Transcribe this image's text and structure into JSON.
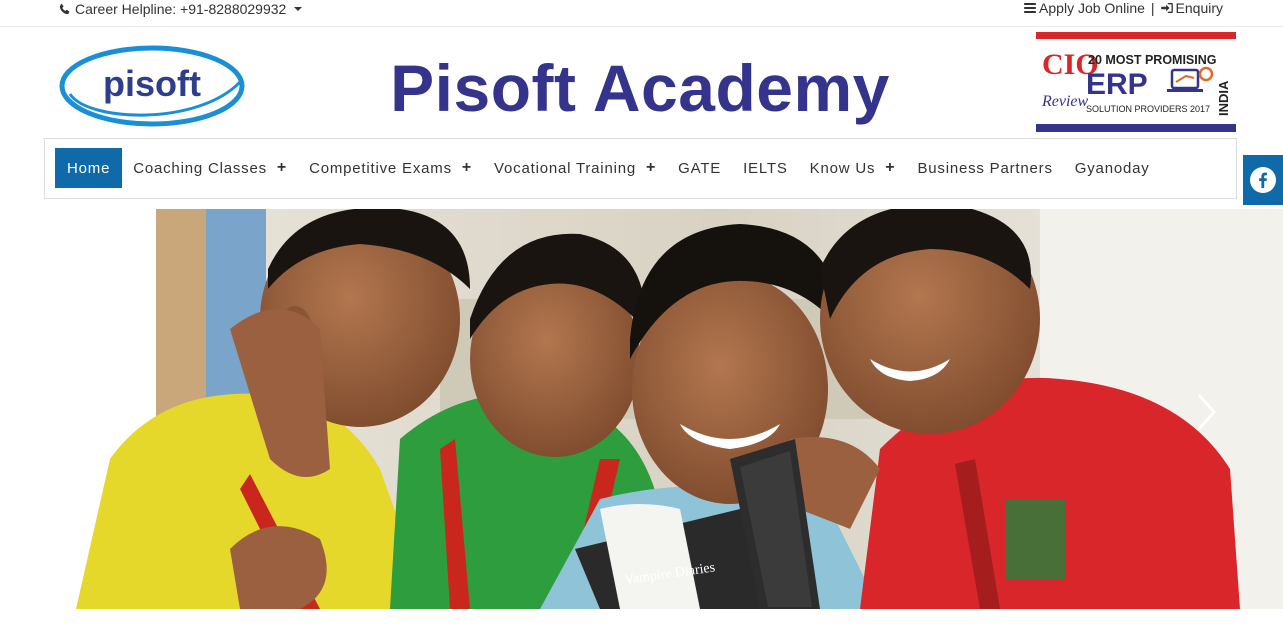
{
  "topbar": {
    "helpline_label": "Career Helpline: +91-8288029932",
    "apply_label": "Apply Job Online",
    "separator": "|",
    "enquiry_label": "Enquiry"
  },
  "header": {
    "logo_text": "pisoft",
    "site_title": "Pisoft Academy",
    "badge": {
      "brand_top": "CIO",
      "brand_bottom": "Review",
      "headline": "20 MOST PROMISING",
      "erp": "ERP",
      "subline": "SOLUTION PROVIDERS 2017",
      "country": "INDIA"
    }
  },
  "nav": {
    "items": [
      {
        "label": "Home",
        "active": true,
        "has_submenu": false
      },
      {
        "label": "Coaching Classes",
        "active": false,
        "has_submenu": true
      },
      {
        "label": "Competitive Exams",
        "active": false,
        "has_submenu": true
      },
      {
        "label": "Vocational Training",
        "active": false,
        "has_submenu": true
      },
      {
        "label": "GATE",
        "active": false,
        "has_submenu": false
      },
      {
        "label": "IELTS",
        "active": false,
        "has_submenu": false
      },
      {
        "label": "Know Us",
        "active": false,
        "has_submenu": true
      },
      {
        "label": "Business Partners",
        "active": false,
        "has_submenu": false
      },
      {
        "label": "Gyanoday",
        "active": false,
        "has_submenu": false
      }
    ],
    "submenu_symbol": "+"
  },
  "slider": {
    "book_title": "Vampire Diaries",
    "image_description_icon": "children-reading-photo"
  },
  "colors": {
    "brand_blue": "#0e6aa8",
    "title_purple": "#35348c",
    "logo_blue": "#1a8fd6",
    "logo_text": "#2d3e8c"
  }
}
